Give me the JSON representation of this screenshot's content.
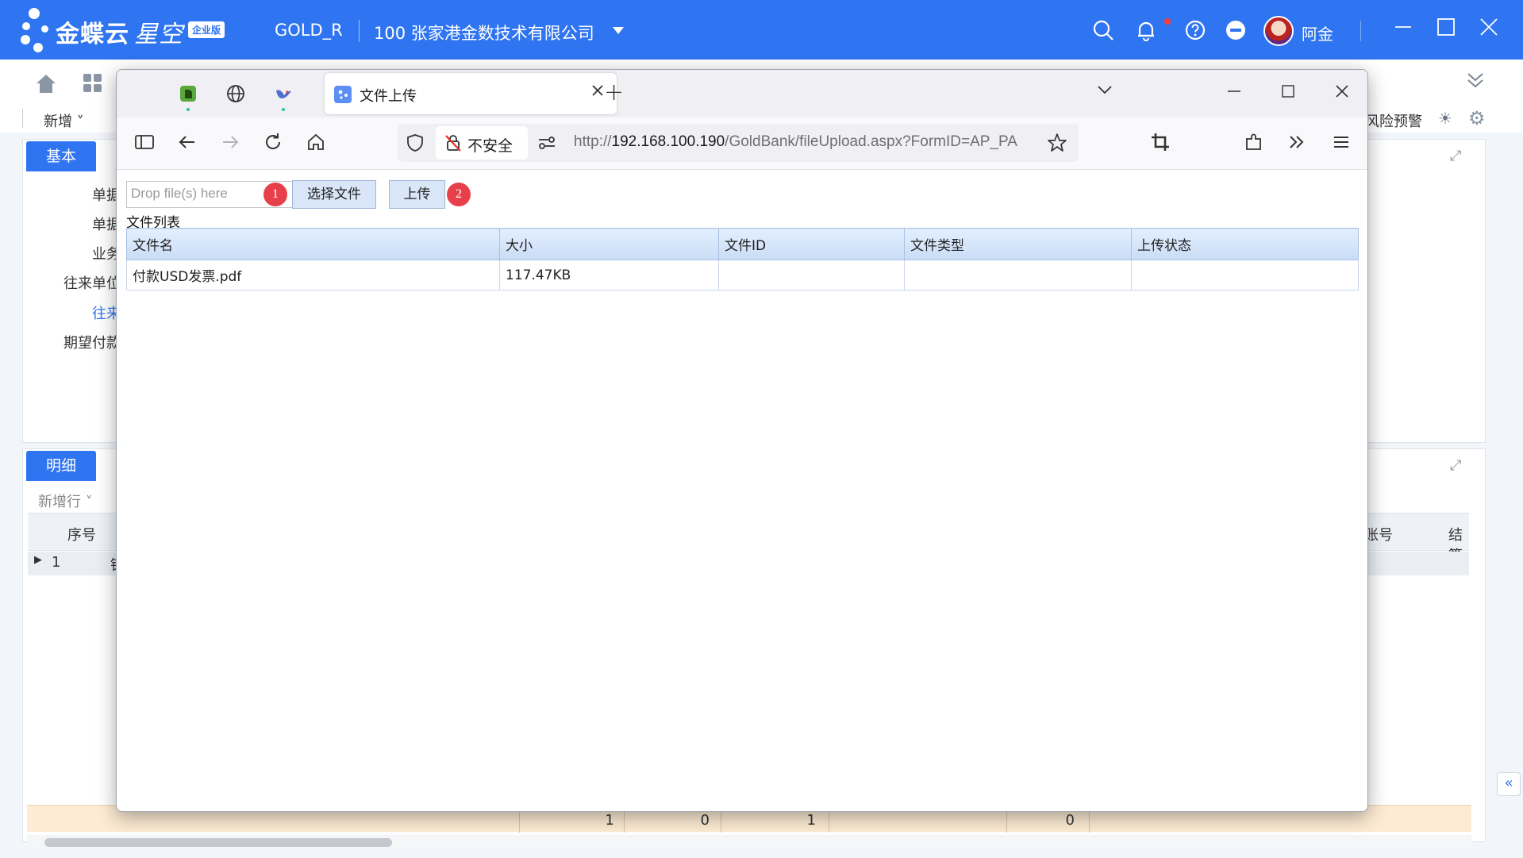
{
  "topbar": {
    "brand": "金蝶云",
    "product": "星空",
    "edition": "企业版",
    "tenant": "GOLD_R",
    "company": "100  张家港金数技术有限公司",
    "user_name": "阿金"
  },
  "background_app": {
    "toolbar": {
      "new_label": "新增",
      "risk_label": "风险预警"
    },
    "header_panel": {
      "tab_label": "基本",
      "fields": [
        "单据",
        "单据",
        "业务",
        "往来单位",
        "往来",
        "期望付款"
      ]
    },
    "detail_panel": {
      "tab_label": "明细",
      "add_row_label": "新增行",
      "columns": {
        "seq": "序号",
        "acct": "账号",
        "settle": "结算"
      },
      "row_seq": "1",
      "row_cell": "银"
    },
    "summary": [
      "1",
      "0",
      "1",
      "0"
    ]
  },
  "browser": {
    "tab_title": "文件上传",
    "security_label": "不安全",
    "url_scheme": "http://",
    "url_host": "192.168.100.190",
    "url_path": "/GoldBank/fileUpload.aspx?FormID=AP_PA"
  },
  "upload": {
    "drop_placeholder": "Drop file(s) here",
    "choose_label": "选择文件",
    "upload_label": "上传",
    "step1": "1",
    "step2": "2",
    "list_title": "文件列表",
    "columns": [
      "文件名",
      "大小",
      "文件ID",
      "文件类型",
      "上传状态"
    ],
    "rows": [
      {
        "name": "付款USD发票.pdf",
        "size": "117.47KB",
        "id": "",
        "type": "",
        "status": ""
      }
    ]
  },
  "colors": {
    "brand_blue": "#2f74f0",
    "badge_red": "#e8404b",
    "summary_bg": "#fdebd3"
  },
  "icons": [
    "search-icon",
    "bell-icon",
    "help-icon",
    "minus-circle-icon",
    "home-icon",
    "grid-icon",
    "globe-icon",
    "back-icon",
    "forward-icon",
    "reload-icon",
    "shield-icon",
    "star-icon",
    "crop-icon",
    "extensions-icon",
    "menu-icon"
  ]
}
